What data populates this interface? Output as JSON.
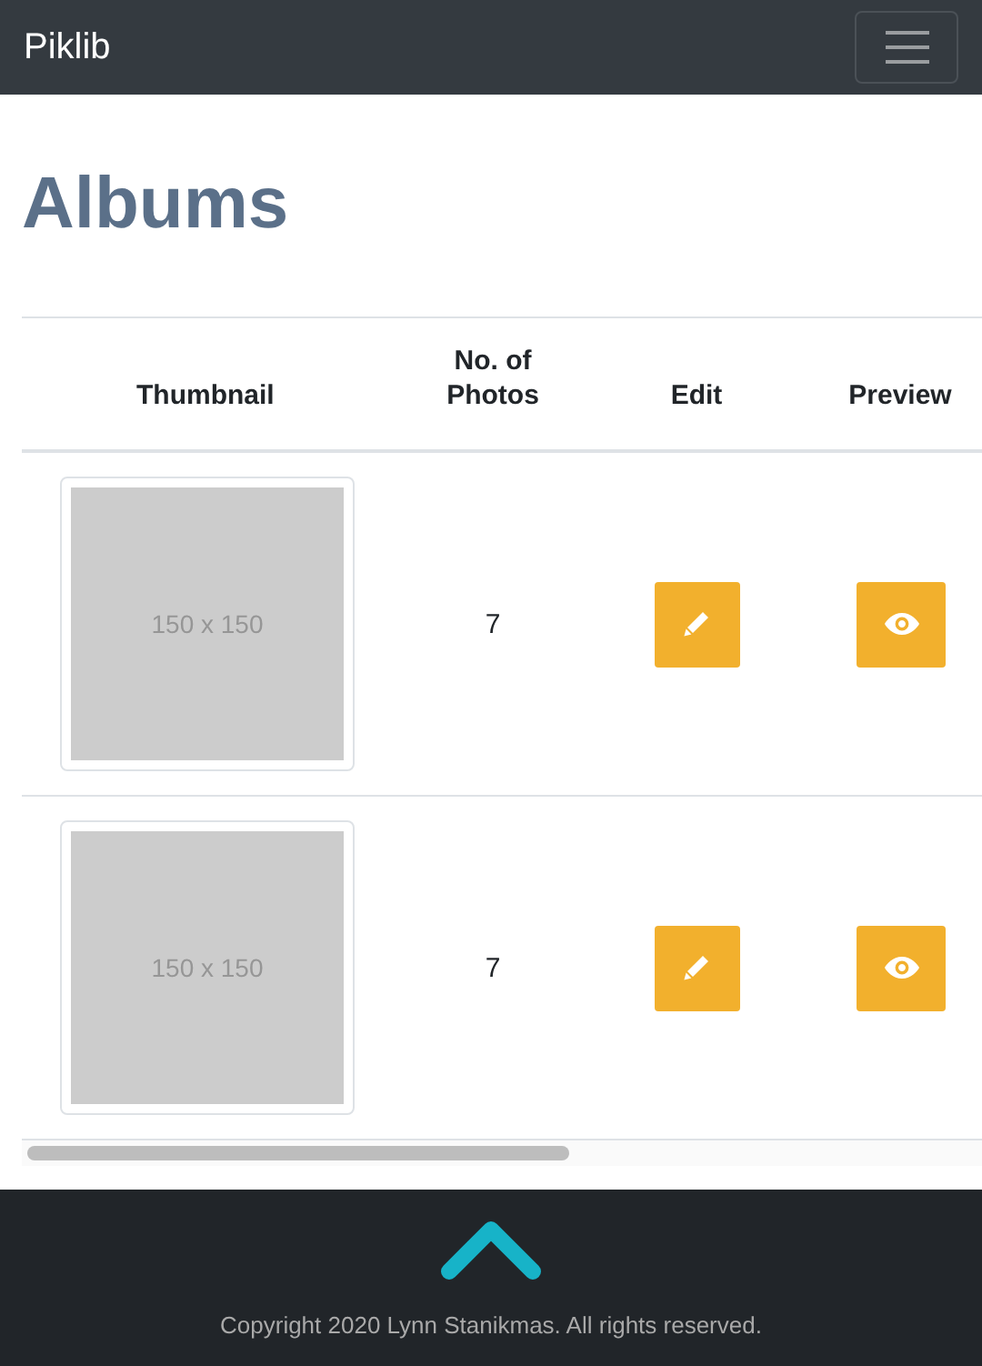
{
  "navbar": {
    "brand": "Piklib"
  },
  "heading": "Albums",
  "table": {
    "columns": [
      "Thumbnail",
      "No. of Photos",
      "Edit",
      "Preview"
    ],
    "rows": [
      {
        "thumbnail": "150 x 150",
        "photos": "7"
      },
      {
        "thumbnail": "150 x 150",
        "photos": "7"
      }
    ]
  },
  "footer": {
    "copyright": "Copyright 2020 Lynn Stanikmas. All rights reserved."
  }
}
